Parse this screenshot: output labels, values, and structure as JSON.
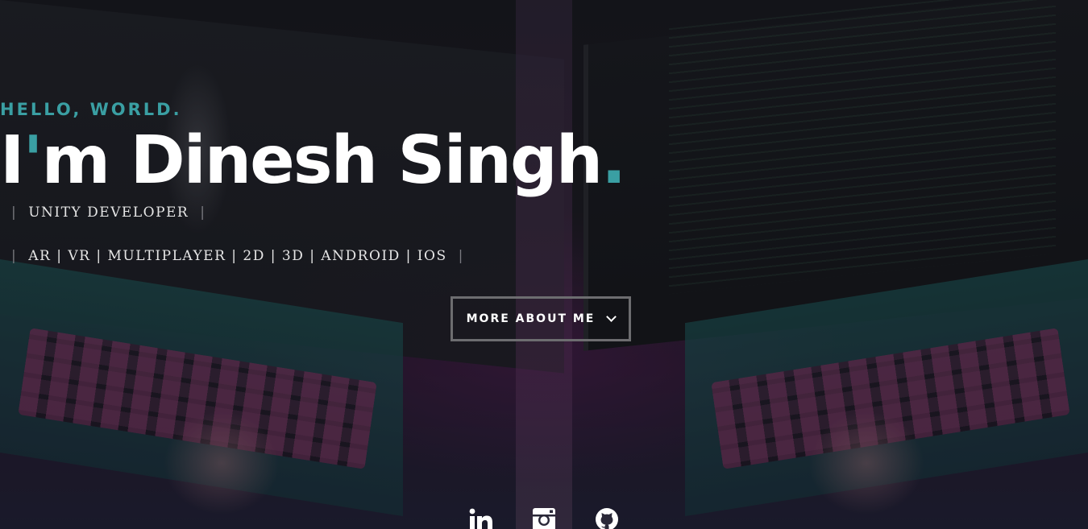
{
  "hero": {
    "greeting": "HELLO, WORLD.",
    "name_prefix": "I",
    "name_apostrophe": "'",
    "name_rest": "m Dinesh Singh",
    "name_dot": ".",
    "role_left_pipe": "|",
    "role": "UNITY DEVELOPER",
    "role_right_pipe": "|",
    "skills_left_pipe": "|",
    "skills": "AR | VR | MULTIPLAYER | 2D | 3D | ANDROID | IOS",
    "skills_right_pipe": "|",
    "cta_label": "MORE ABOUT ME",
    "cta_icon": "chevron-down-icon"
  },
  "social": [
    {
      "icon": "linkedin-icon"
    },
    {
      "icon": "instagram-icon"
    },
    {
      "icon": "github-icon"
    }
  ],
  "colors": {
    "accent": "#3a9fa3",
    "text": "#ffffff",
    "muted_text": "#e6e6e6",
    "button_border": "#6d6d70"
  }
}
